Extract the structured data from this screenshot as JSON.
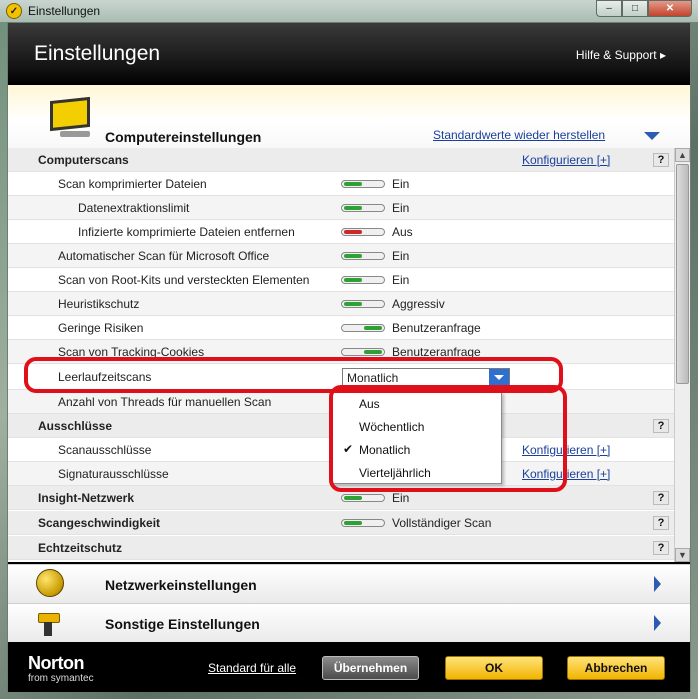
{
  "window": {
    "title": "Einstellungen"
  },
  "header": {
    "title": "Einstellungen",
    "help": "Hilfe & Support ▸"
  },
  "section": {
    "title": "Computereinstellungen",
    "reset_link": "Standardwerte wieder herstellen"
  },
  "categories": {
    "computerscans": {
      "label": "Computerscans",
      "configure": "Konfigurieren [+]"
    },
    "ausschluesse": {
      "label": "Ausschlüsse"
    },
    "insight": {
      "label": "Insight-Netzwerk",
      "value": "Ein"
    },
    "scanspeed": {
      "label": "Scangeschwindigkeit",
      "value": "Vollständiger Scan"
    },
    "echtzeit": {
      "label": "Echtzeitschutz"
    }
  },
  "settings": [
    {
      "label": "Scan komprimierter Dateien",
      "value": "Ein"
    },
    {
      "label": "Datenextraktionslimit",
      "value": "Ein"
    },
    {
      "label": "Infizierte komprimierte Dateien entfernen",
      "value": "Aus"
    },
    {
      "label": "Automatischer Scan für Microsoft Office",
      "value": "Ein"
    },
    {
      "label": "Scan von Root-Kits und versteckten Elementen",
      "value": "Ein"
    },
    {
      "label": "Heuristikschutz",
      "value": "Aggressiv"
    },
    {
      "label": "Geringe Risiken",
      "value": "Benutzeranfrage"
    },
    {
      "label": "Scan von Tracking-Cookies",
      "value": "Benutzeranfrage"
    },
    {
      "label": "Leerlaufzeitscans",
      "value": "Monatlich"
    },
    {
      "label": "Anzahl von Threads für manuellen Scan"
    }
  ],
  "exclusions": [
    {
      "label": "Scanausschlüsse",
      "configure": "Konfigurieren [+]"
    },
    {
      "label": "Signaturausschlüsse",
      "configure": "Konfigurieren [+]"
    }
  ],
  "dropdown": {
    "options": [
      "Aus",
      "Wöchentlich",
      "Monatlich",
      "Vierteljährlich"
    ],
    "selected": "Monatlich"
  },
  "panels": {
    "network": "Netzwerkeinstellungen",
    "other": "Sonstige Einstellungen"
  },
  "help_icon": "?",
  "footer": {
    "brand": "Norton",
    "brand_sub": "from symantec",
    "default_link": "Standard für alle",
    "apply": "Übernehmen",
    "ok": "OK",
    "cancel": "Abbrechen"
  },
  "colors": {
    "toggle_on": "#2fa033",
    "toggle_off": "#c92a2a",
    "highlight": "#e0101a",
    "link": "#1a3f9c"
  }
}
